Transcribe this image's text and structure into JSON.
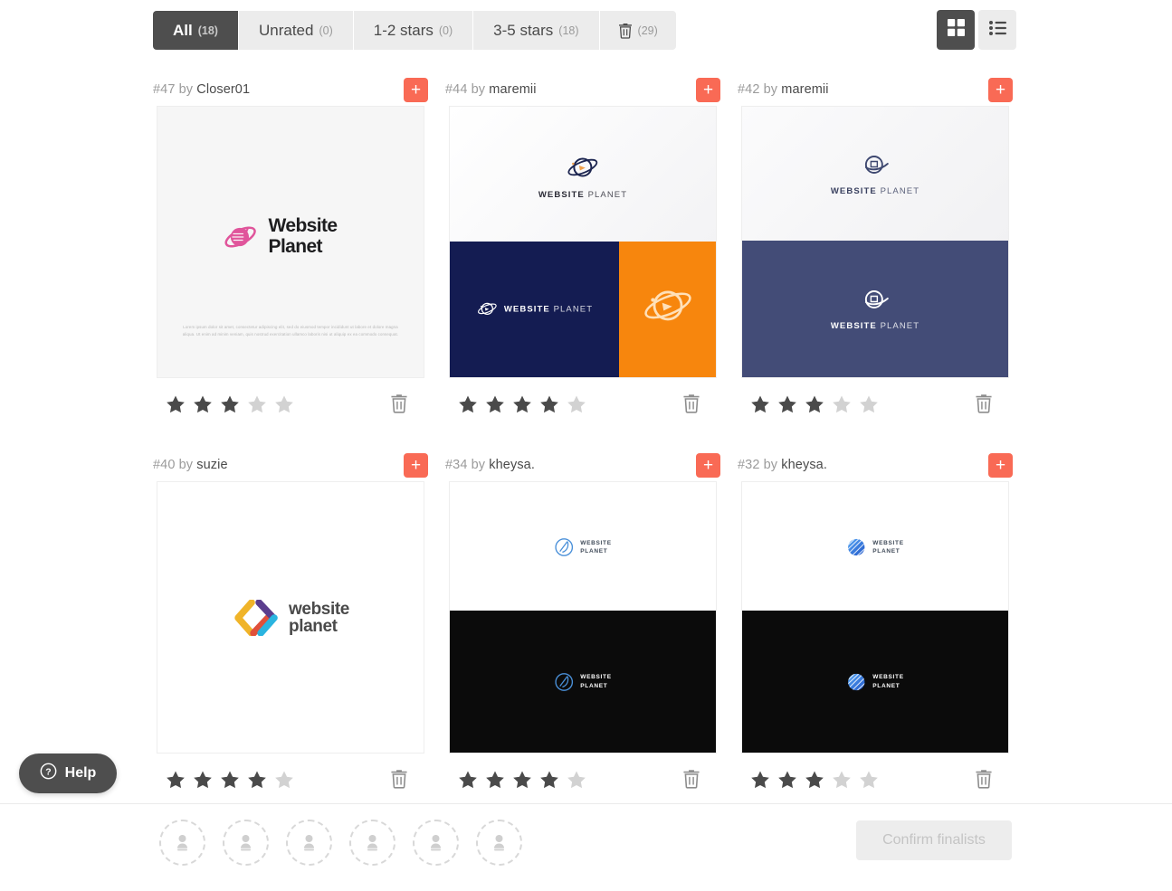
{
  "filters": {
    "tabs": [
      {
        "label": "All",
        "count": "(18)",
        "active": true,
        "name": "filter-tab-all"
      },
      {
        "label": "Unrated",
        "count": "(0)",
        "active": false,
        "name": "filter-tab-unrated"
      },
      {
        "label": "1-2 stars",
        "count": "(0)",
        "active": false,
        "name": "filter-tab-1-2-stars"
      },
      {
        "label": "3-5 stars",
        "count": "(18)",
        "active": false,
        "name": "filter-tab-3-5-stars"
      }
    ],
    "trash": {
      "icon": "trash-icon",
      "count": "(29)"
    }
  },
  "view_toggle": {
    "grid": {
      "icon": "grid-view-icon",
      "active": true
    },
    "list": {
      "icon": "list-view-icon",
      "active": false
    }
  },
  "colors": {
    "accent": "#f96a55",
    "active_tab_bg": "#4e4e4e",
    "inactive_tab_bg": "#ececec",
    "star_filled": "#4a4a4a",
    "star_empty": "#d2d2d2",
    "navy": "#141c52",
    "orange": "#f7860d",
    "slate": "#434c77",
    "black": "#0b0b0b",
    "pink": "#e0559b",
    "blue": "#2f7fe0"
  },
  "cards": [
    {
      "id": "#47",
      "by": "by",
      "author": "Closer01",
      "rating": 3,
      "max_rating": 5,
      "add_label": "+",
      "logo_text": "Website Planet",
      "lorem": "Lorem ipsum dolor sit amet, consectetur adipiscing elit, sed do eiusmod tempor incididunt ut labore et dolore magna aliqua. Ut enim ad minim veniam, quis nostrud exercitation ullamco laboris nisi ut aliquip ex ea commodo consequat."
    },
    {
      "id": "#44",
      "by": "by",
      "author": "maremii",
      "rating": 4,
      "max_rating": 5,
      "add_label": "+",
      "logo_text_bold": "WEBSITE",
      "logo_text_light": "PLANET"
    },
    {
      "id": "#42",
      "by": "by",
      "author": "maremii",
      "rating": 3,
      "max_rating": 5,
      "add_label": "+",
      "logo_text_bold": "WEBSITE",
      "logo_text_light": "PLANET"
    },
    {
      "id": "#40",
      "by": "by",
      "author": "suzie",
      "rating": 4,
      "max_rating": 5,
      "add_label": "+",
      "logo_line1": "website",
      "logo_line2": "planet"
    },
    {
      "id": "#34",
      "by": "by",
      "author": "kheysa.",
      "rating": 4,
      "max_rating": 5,
      "add_label": "+",
      "logo_line1": "WEBSITE",
      "logo_line2": "PLANET"
    },
    {
      "id": "#32",
      "by": "by",
      "author": "kheysa.",
      "rating": 3,
      "max_rating": 5,
      "add_label": "+",
      "logo_line1": "WEBSITE",
      "logo_line2": "PLANET"
    }
  ],
  "help": {
    "label": "Help",
    "icon": "question-mark-icon"
  },
  "bottom_bar": {
    "finalist_slots": 6,
    "slot_icon": "person-placeholder-icon",
    "confirm_label": "Confirm finalists",
    "confirm_enabled": false
  }
}
